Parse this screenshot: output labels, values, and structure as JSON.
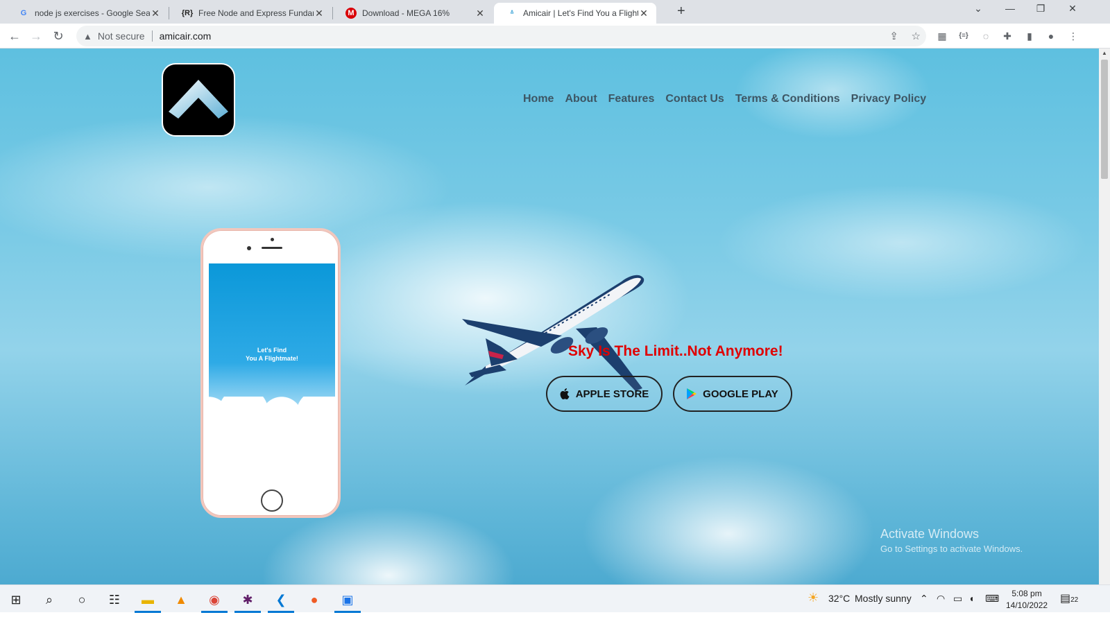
{
  "browser": {
    "tabs": [
      {
        "title": "node js exercises - Google Search",
        "favicon": "google-icon"
      },
      {
        "title": "Free Node and Express Fundamentals",
        "favicon": "r-icon"
      },
      {
        "title": "Download - MEGA 16%",
        "favicon": "mega-icon"
      },
      {
        "title": "Amicair | Let's Find You a Flightmate",
        "favicon": "amicair-icon",
        "active": true
      }
    ],
    "address": {
      "security_label": "Not secure",
      "url": "amicair.com"
    }
  },
  "site": {
    "nav": [
      "Home",
      "About",
      "Features",
      "Contact Us",
      "Terms & Conditions",
      "Privacy Policy"
    ],
    "phone_text": [
      "Let's Find",
      "You A Flightmate!"
    ],
    "tagline": "Sky Is The Limit..Not Anymore!",
    "buttons": {
      "apple": "APPLE STORE",
      "google": "GOOGLE PLAY"
    },
    "colors": {
      "tagline": "#e00000",
      "nav": "#3d5563"
    }
  },
  "watermark": {
    "title": "Activate Windows",
    "subtitle": "Go to Settings to activate Windows."
  },
  "taskbar": {
    "weather": {
      "temp": "32°C",
      "condition": "Mostly sunny"
    },
    "time": "5:08 pm",
    "date": "14/10/2022",
    "notification_count": "22"
  }
}
